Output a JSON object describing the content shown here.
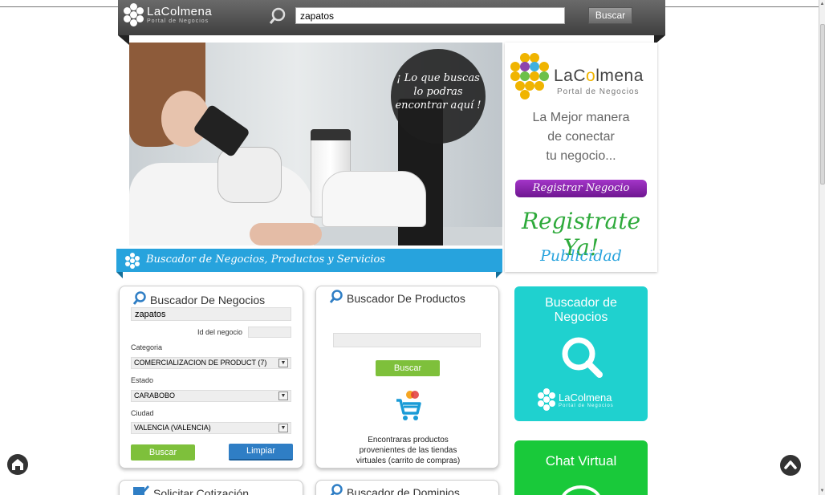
{
  "header": {
    "logo_name": "LaColmena",
    "logo_sub": "Portal de Negocios",
    "search_value": "zapatos",
    "search_button": "Buscar"
  },
  "hero": {
    "bubble_line1": "¡ Lo que buscas",
    "bubble_line2": "lo podras",
    "bubble_line3": "encontrar aquí !"
  },
  "banner": {
    "text": "Buscador de Negocios, Productos y Servicios"
  },
  "promo": {
    "logo_name_a": "LaC",
    "logo_name_o": "o",
    "logo_name_b": "lmena",
    "logo_sub": "Portal de Negocios",
    "tagline1": "La Mejor manera",
    "tagline2": "de conectar",
    "tagline3": "tu negocio...",
    "register_button": "Registrar Negocio",
    "register_now": "Registrate Ya!",
    "publicidad": "Publicidad"
  },
  "business_search": {
    "title": "Buscador De Negocios",
    "query_value": "zapatos",
    "id_label": "Id del negocio",
    "id_value": "",
    "category_label": "Categoria",
    "category_value": "COMERCIALIZACION DE PRODUCT (7)",
    "state_label": "Estado",
    "state_value": "CARABOBO",
    "city_label": "Ciudad",
    "city_value": "VALENCIA (VALENCIA)",
    "search_button": "Buscar",
    "clear_button": "Limpiar"
  },
  "product_search": {
    "title": "Buscador De Productos",
    "query_value": "",
    "search_button": "Buscar",
    "description_line1": "Encontraras productos",
    "description_line2": "provenientes de las tiendas",
    "description_line3": "virtuales (carrito de compras)"
  },
  "bottom_cards": {
    "left_title": "Solicitar Cotización",
    "right_title": "Buscador de Dominios"
  },
  "tiles": {
    "business_title1": "Buscador de",
    "business_title2": "Negocios",
    "business_logo_name": "LaColmena",
    "business_logo_sub": "Portal de Negocios",
    "chat_title": "Chat Virtual"
  },
  "colors": {
    "banner_blue": "#27a3dd",
    "tile_cyan": "#1fd1cf",
    "tile_green": "#19c93a",
    "button_green": "#7ec03b",
    "button_blue": "#2f7ec5",
    "register_purple": "#8a24b0"
  },
  "icons": {
    "home": "home-icon",
    "scroll_top": "chevron-up-icon",
    "search": "search-icon",
    "cart": "cart-icon",
    "chat": "chat-bubble-icon"
  }
}
